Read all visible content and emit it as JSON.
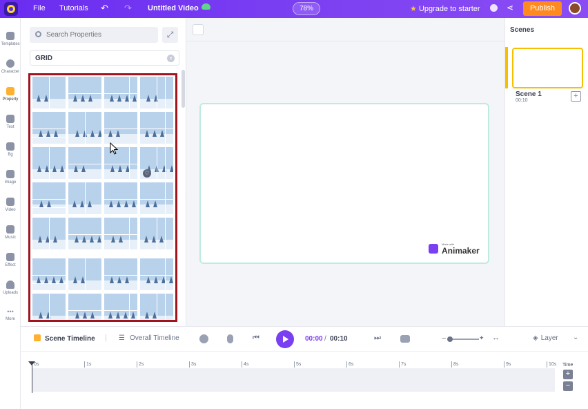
{
  "topbar": {
    "file": "File",
    "tutorials": "Tutorials",
    "title": "Untitled Video",
    "zoom": "78%",
    "upgrade": "Upgrade to starter",
    "publish": "Publish"
  },
  "sidebar": {
    "items": [
      {
        "label": "Templates",
        "icon": "templates-icon"
      },
      {
        "label": "Character",
        "icon": "character-icon"
      },
      {
        "label": "Property",
        "icon": "property-icon"
      },
      {
        "label": "Text",
        "icon": "text-icon"
      },
      {
        "label": "Bg",
        "icon": "bg-icon"
      },
      {
        "label": "Image",
        "icon": "image-icon"
      },
      {
        "label": "Video",
        "icon": "video-icon"
      },
      {
        "label": "Music",
        "icon": "music-icon"
      },
      {
        "label": "Effect",
        "icon": "effect-icon"
      },
      {
        "label": "Uploads",
        "icon": "uploads-icon"
      },
      {
        "label": "More",
        "icon": "more-icon"
      }
    ],
    "active": "Property"
  },
  "panel": {
    "search_placeholder": "Search Properties",
    "filter_chip": "GRID"
  },
  "stage": {
    "watermark_small": "Made with",
    "watermark_brand": "Animaker"
  },
  "scenes": {
    "title": "Scenes",
    "items": [
      {
        "name": "Scene 1",
        "duration": "00:10"
      }
    ]
  },
  "timeline": {
    "scene_tab": "Scene Timeline",
    "overall_tab": "Overall Timeline",
    "current_time": "00:00",
    "separator": "/",
    "total_time": "00:10",
    "layer": "Layer",
    "ticks": [
      "0s",
      "1s",
      "2s",
      "3s",
      "4s",
      "5s",
      "6s",
      "7s",
      "8s",
      "9s",
      "10s"
    ],
    "time_label": "Time"
  },
  "colors": {
    "topbar": "#7b3ff2",
    "publish": "#ff8a1f",
    "accent": "#7b3ff2",
    "highlight_border": "#a3131d",
    "scene_active": "#f6c000"
  }
}
